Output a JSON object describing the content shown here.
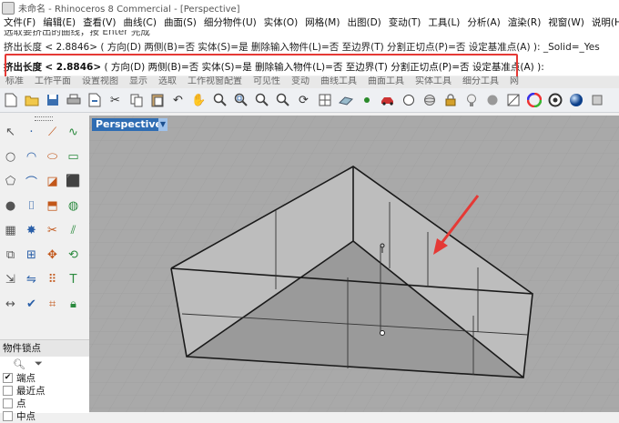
{
  "window": {
    "title": "未命名 - Rhinoceros 8 Commercial - [Perspective]"
  },
  "menu": [
    "文件(F)",
    "编辑(E)",
    "查看(V)",
    "曲线(C)",
    "曲面(S)",
    "细分物件(U)",
    "实体(O)",
    "网格(M)",
    "出图(D)",
    "变动(T)",
    "工具(L)",
    "分析(A)",
    "渲染(R)",
    "视窗(W)",
    "说明(H)"
  ],
  "command_history": {
    "line1": "选取要挤出的曲线，按 Enter 完成",
    "line2": "挤出长度 < 2.8846> ( 方向(D)  两侧(B)=否  实体(S)=是  删除输入物件(L)=否  至边界(T)  分割正切点(P)=否  设定基准点(A) ): _Solid=_Yes"
  },
  "command_line": {
    "label": "挤出长度",
    "value": "< 2.8846>",
    "open": "(",
    "opt_dir": "方向(D)",
    "opt_both": "两侧(B)=否",
    "opt_solid": "实体(S)=是",
    "opt_delete": "删除输入物件(L)=否",
    "opt_boundary": "至边界(T)",
    "opt_split": "分割正切点(P)=否",
    "opt_base": "设定基准点(A)",
    "close": "):"
  },
  "toolbar_tabs": [
    "标准",
    "工作平面",
    "设置视图",
    "显示",
    "选取",
    "工作视窗配置",
    "可见性",
    "变动",
    "曲线工具",
    "曲面工具",
    "实体工具",
    "细分工具",
    "网"
  ],
  "toolbar_icons": [
    "new-icon",
    "open-icon",
    "save-icon",
    "print-icon",
    "import-icon",
    "cut-icon",
    "copy-icon",
    "paste-icon",
    "undo-icon",
    "pan-icon",
    "zoom-icon",
    "zoom-window-icon",
    "zoom-extents-icon",
    "zoom-selected-icon",
    "rotate-view-icon",
    "four-view-icon",
    "set-cplane-icon",
    "point-icon",
    "car-icon",
    "circle-icon",
    "sphere-icon",
    "lock-icon",
    "light-bulb-icon",
    "shade-icon",
    "material-icon",
    "color-wheel-icon",
    "render-icon",
    "sphere-render-icon",
    "settings-icon"
  ],
  "left_tools": [
    "select-icon",
    "point-icon",
    "polyline-icon",
    "curve-icon",
    "circle-icon",
    "arc-icon",
    "ellipse-icon",
    "rectangle-icon",
    "polygon-icon",
    "fillet-icon",
    "surface-icon",
    "solid-box-icon",
    "sphere-icon",
    "cylinder-icon",
    "extrude-icon",
    "boolean-icon",
    "mesh-icon",
    "explode-icon",
    "trim-icon",
    "split-icon",
    "join-icon",
    "group-icon",
    "move-icon",
    "rotate-icon",
    "scale-icon",
    "mirror-icon",
    "array-icon",
    "text-icon",
    "dimension-icon",
    "check-icon",
    "analyze-icon",
    "lock-icon"
  ],
  "osnap": {
    "title": "物件锁点",
    "options": [
      {
        "label": "端点",
        "checked": true
      },
      {
        "label": "最近点",
        "checked": false
      },
      {
        "label": "点",
        "checked": false
      },
      {
        "label": "中点",
        "checked": false
      }
    ]
  },
  "viewport": {
    "label": "Perspective"
  },
  "colors": {
    "accent": "#2f6db3",
    "highlight": "#e53935",
    "viewport_bg": "#a9a9a9"
  }
}
